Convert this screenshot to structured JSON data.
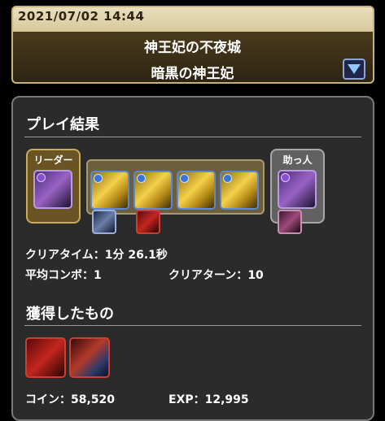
{
  "header": {
    "datetime": "2021/07/02 14:44",
    "dungeon_name": "神王妃の不夜城",
    "floor_name": "暗黒の神王妃"
  },
  "result": {
    "title": "プレイ結果",
    "leader_label": "リーダー",
    "helper_label": "助っ人",
    "clear_time_label": "クリアタイム：",
    "clear_time_value": "1分 26.1秒",
    "avg_combo_label": "平均コンボ：",
    "avg_combo_value": "1",
    "clear_turn_label": "クリアターン：",
    "clear_turn_value": "10"
  },
  "rewards": {
    "title": "獲得したもの",
    "coin_label": "コイン：",
    "coin_value": "58,520",
    "exp_label": "EXP：",
    "exp_value": "12,995"
  }
}
